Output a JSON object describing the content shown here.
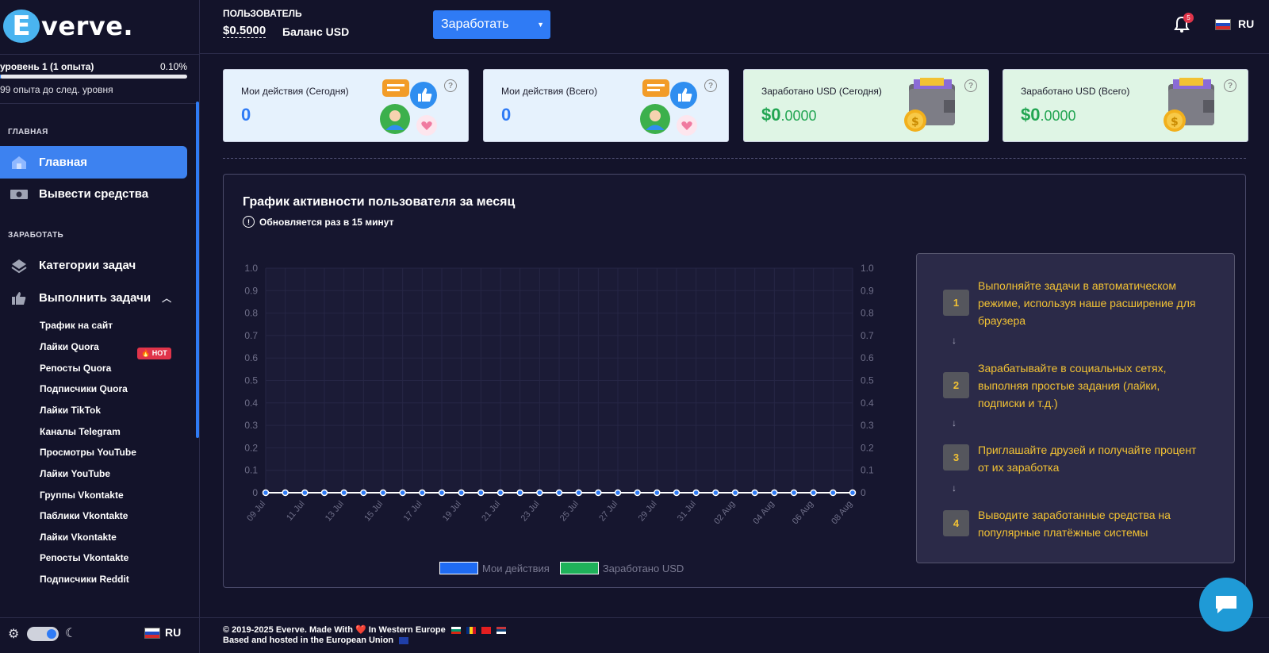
{
  "sidebar": {
    "logo_letter": "E",
    "logo_text": "verve.",
    "level_label": "уровень 1 (1 опыта)",
    "level_percent": "0.10%",
    "level_progress": 0.001,
    "level_sub": "99 опыта до след. уровня",
    "section_main": "ГЛАВНАЯ",
    "section_earn": "ЗАРАБОТАТЬ",
    "nav": {
      "home": "Главная",
      "withdraw": "Вывести средства",
      "categories": "Категории задач",
      "do_tasks": "Выполнить задачи"
    },
    "sub_items": [
      "Трафик на сайт",
      "Лайки Quora",
      "Репосты Quora",
      "Подписчики Quora",
      "Лайки TikTok",
      "Каналы Telegram",
      "Просмотры YouTube",
      "Лайки YouTube",
      "Группы Vkontakte",
      "Паблики Vkontakte",
      "Лайки Vkontakte",
      "Репосты Vkontakte",
      "Подписчики Reddit"
    ],
    "hot_badge": "🔥 HOT",
    "lang": "RU"
  },
  "header": {
    "user_label": "ПОЛЬЗОВАТЕЛЬ",
    "balance": "$0.5000",
    "balance_label": "Баланс USD",
    "earn_button": "Заработать",
    "notification_count": "5",
    "lang": "RU"
  },
  "cards": [
    {
      "label": "Мои действия (Сегодня)",
      "value": "0"
    },
    {
      "label": "Мои действия (Всего)",
      "value": "0"
    },
    {
      "label": "Заработано USD (Сегодня)",
      "value_main": "$0",
      "value_dec": ".0000"
    },
    {
      "label": "Заработано USD (Всего)",
      "value_main": "$0",
      "value_dec": ".0000"
    }
  ],
  "panel": {
    "title": "График активности пользователя за месяц",
    "subtitle": "Обновляется раз в 15 минут"
  },
  "chart_data": {
    "type": "line",
    "x": [
      "09 Jul",
      "10 Jul",
      "11 Jul",
      "12 Jul",
      "13 Jul",
      "14 Jul",
      "15 Jul",
      "16 Jul",
      "17 Jul",
      "18 Jul",
      "19 Jul",
      "20 Jul",
      "21 Jul",
      "22 Jul",
      "23 Jul",
      "24 Jul",
      "25 Jul",
      "26 Jul",
      "27 Jul",
      "28 Jul",
      "29 Jul",
      "30 Jul",
      "31 Jul",
      "01 Aug",
      "02 Aug",
      "03 Aug",
      "04 Aug",
      "05 Aug",
      "06 Aug",
      "07 Aug",
      "08 Aug"
    ],
    "x_tick_labels": [
      "09 Jul",
      "11 Jul",
      "13 Jul",
      "15 Jul",
      "17 Jul",
      "19 Jul",
      "21 Jul",
      "23 Jul",
      "25 Jul",
      "27 Jul",
      "29 Jul",
      "31 Jul",
      "02 Aug",
      "04 Aug",
      "06 Aug",
      "08 Aug"
    ],
    "y_ticks": [
      "0",
      "0.1",
      "0.2",
      "0.3",
      "0.4",
      "0.5",
      "0.6",
      "0.7",
      "0.8",
      "0.9",
      "1.0"
    ],
    "ylim": [
      0,
      1
    ],
    "series": [
      {
        "name": "Мои действия",
        "color": "#1f6bf2",
        "values": [
          0,
          0,
          0,
          0,
          0,
          0,
          0,
          0,
          0,
          0,
          0,
          0,
          0,
          0,
          0,
          0,
          0,
          0,
          0,
          0,
          0,
          0,
          0,
          0,
          0,
          0,
          0,
          0,
          0,
          0,
          0
        ]
      },
      {
        "name": "Заработано USD",
        "color": "#1fb25a",
        "values": [
          0,
          0,
          0,
          0,
          0,
          0,
          0,
          0,
          0,
          0,
          0,
          0,
          0,
          0,
          0,
          0,
          0,
          0,
          0,
          0,
          0,
          0,
          0,
          0,
          0,
          0,
          0,
          0,
          0,
          0,
          0
        ]
      }
    ],
    "grid": true,
    "legend": "bottom"
  },
  "steps": [
    {
      "num": "1",
      "text": "Выполняйте задачи в автоматическом режиме, используя наше расширение для браузера"
    },
    {
      "num": "2",
      "text": "Зарабатывайте в социальных сетях, выполняя простые задания (лайки, подписки и т.д.)"
    },
    {
      "num": "3",
      "text": "Приглашайте друзей и получайте процент от их заработка"
    },
    {
      "num": "4",
      "text": "Выводите заработанные средства на популярные платёжные системы"
    }
  ],
  "footer": {
    "line1": "© 2019-2025 Everve. Made With ❤️ In Western Europe",
    "line2": "Based and hosted in the European Union"
  },
  "colors": {
    "accent": "#2f7bf5",
    "money": "#22a552",
    "step_text": "#f2c234",
    "hot": "#e0344a"
  }
}
